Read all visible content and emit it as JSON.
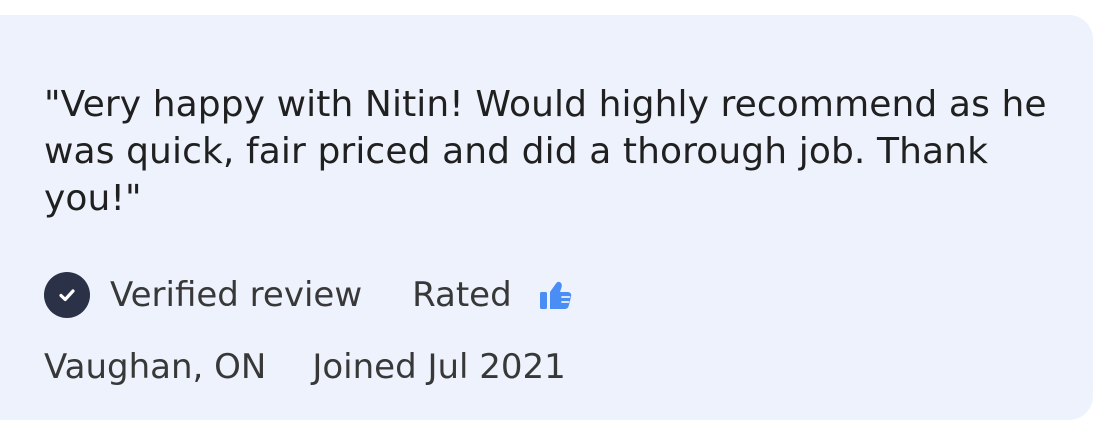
{
  "review": {
    "text": "\"Very happy with Nitin! Would highly recommend as he was quick, fair priced and did a thorough job. Thank you!\"",
    "verified_label": "Verified review",
    "rated_label": "Rated",
    "location": "Vaughan, ON",
    "joined": "Joined Jul 2021"
  },
  "icons": {
    "verified": "check-circle-icon",
    "rating": "thumbs-up-icon"
  },
  "colors": {
    "card_background": "#edf2fc",
    "text_primary": "#202020",
    "text_secondary": "#383838",
    "verified_badge": "#2b3247",
    "thumb_accent": "#4a8ef5"
  }
}
